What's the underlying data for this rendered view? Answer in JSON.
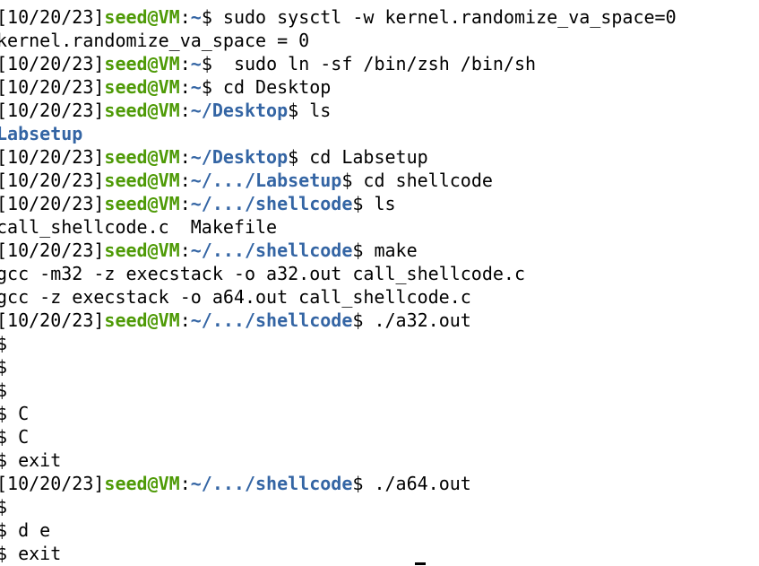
{
  "colors": {
    "background": "#ffffff",
    "text": "#000000",
    "user_host": "#4e9a06",
    "path": "#3465a4"
  },
  "lines": [
    {
      "kind": "prompt",
      "date": "[10/20/23]",
      "user": "seed@VM",
      "path": "~",
      "cmd": " sudo sysctl -w kernel.randomize_va_space=0"
    },
    {
      "kind": "out",
      "text": "kernel.randomize_va_space = 0"
    },
    {
      "kind": "prompt",
      "date": "[10/20/23]",
      "user": "seed@VM",
      "path": "~",
      "cmd": "  sudo ln -sf /bin/zsh /bin/sh"
    },
    {
      "kind": "prompt",
      "date": "[10/20/23]",
      "user": "seed@VM",
      "path": "~",
      "cmd": " cd Desktop"
    },
    {
      "kind": "prompt",
      "date": "[10/20/23]",
      "user": "seed@VM",
      "path": "~/Desktop",
      "cmd": " ls"
    },
    {
      "kind": "dir",
      "text": "Labsetup"
    },
    {
      "kind": "prompt",
      "date": "[10/20/23]",
      "user": "seed@VM",
      "path": "~/Desktop",
      "cmd": " cd Labsetup"
    },
    {
      "kind": "prompt",
      "date": "[10/20/23]",
      "user": "seed@VM",
      "path": "~/.../Labsetup",
      "cmd": " cd shellcode"
    },
    {
      "kind": "prompt",
      "date": "[10/20/23]",
      "user": "seed@VM",
      "path": "~/.../shellcode",
      "cmd": " ls"
    },
    {
      "kind": "out",
      "text": "call_shellcode.c  Makefile"
    },
    {
      "kind": "prompt",
      "date": "[10/20/23]",
      "user": "seed@VM",
      "path": "~/.../shellcode",
      "cmd": " make"
    },
    {
      "kind": "out",
      "text": "gcc -m32 -z execstack -o a32.out call_shellcode.c"
    },
    {
      "kind": "out",
      "text": "gcc -z execstack -o a64.out call_shellcode.c"
    },
    {
      "kind": "prompt",
      "date": "[10/20/23]",
      "user": "seed@VM",
      "path": "~/.../shellcode",
      "cmd": " ./a32.out"
    },
    {
      "kind": "out",
      "text": "$"
    },
    {
      "kind": "out",
      "text": "$"
    },
    {
      "kind": "out",
      "text": "$"
    },
    {
      "kind": "out",
      "text": "$ C"
    },
    {
      "kind": "out",
      "text": "$ C"
    },
    {
      "kind": "out",
      "text": "$ exit"
    },
    {
      "kind": "prompt",
      "date": "[10/20/23]",
      "user": "seed@VM",
      "path": "~/.../shellcode",
      "cmd": " ./a64.out"
    },
    {
      "kind": "out",
      "text": "$"
    },
    {
      "kind": "out",
      "text": "$ d e"
    },
    {
      "kind": "out",
      "text": "$ exit"
    }
  ]
}
